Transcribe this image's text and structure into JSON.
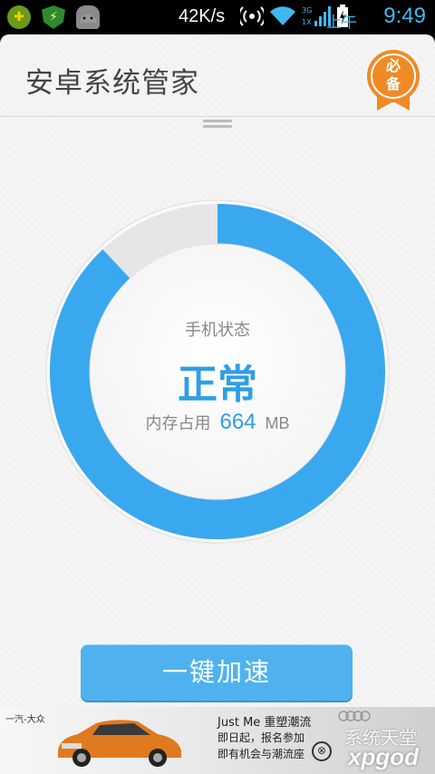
{
  "status_bar": {
    "net_speed": "42K/s",
    "ampm": "上午",
    "time": "9:49",
    "apps": [
      "plus-app-icon",
      "shield-app-icon",
      "android-icon"
    ],
    "signal_label_top": "3G",
    "signal_label_bottom": "1X"
  },
  "header": {
    "title": "安卓系统管家",
    "badge_text": "必备"
  },
  "gauge": {
    "label": "手机状态",
    "status": "正常",
    "memory_label": "内存占用",
    "memory_value": "664",
    "memory_unit": "MB",
    "fill_fraction": 0.88,
    "colors": {
      "fill": "#3aa8ef",
      "track": "#e6e6e6"
    }
  },
  "action": {
    "accelerate_label": "一键加速"
  },
  "ad": {
    "brand_left": "一汽-大众",
    "line1": "Just Me 重塑潮流",
    "line2": "即日起，报名参加",
    "line3": "即有机会与潮流座",
    "audi_text": "Audi"
  },
  "watermark": {
    "cn": "系统天堂",
    "en": "xpgod"
  },
  "colors": {
    "accent": "#3aa8ef",
    "badge": "#f08a24",
    "clock": "#3fb8f0"
  }
}
